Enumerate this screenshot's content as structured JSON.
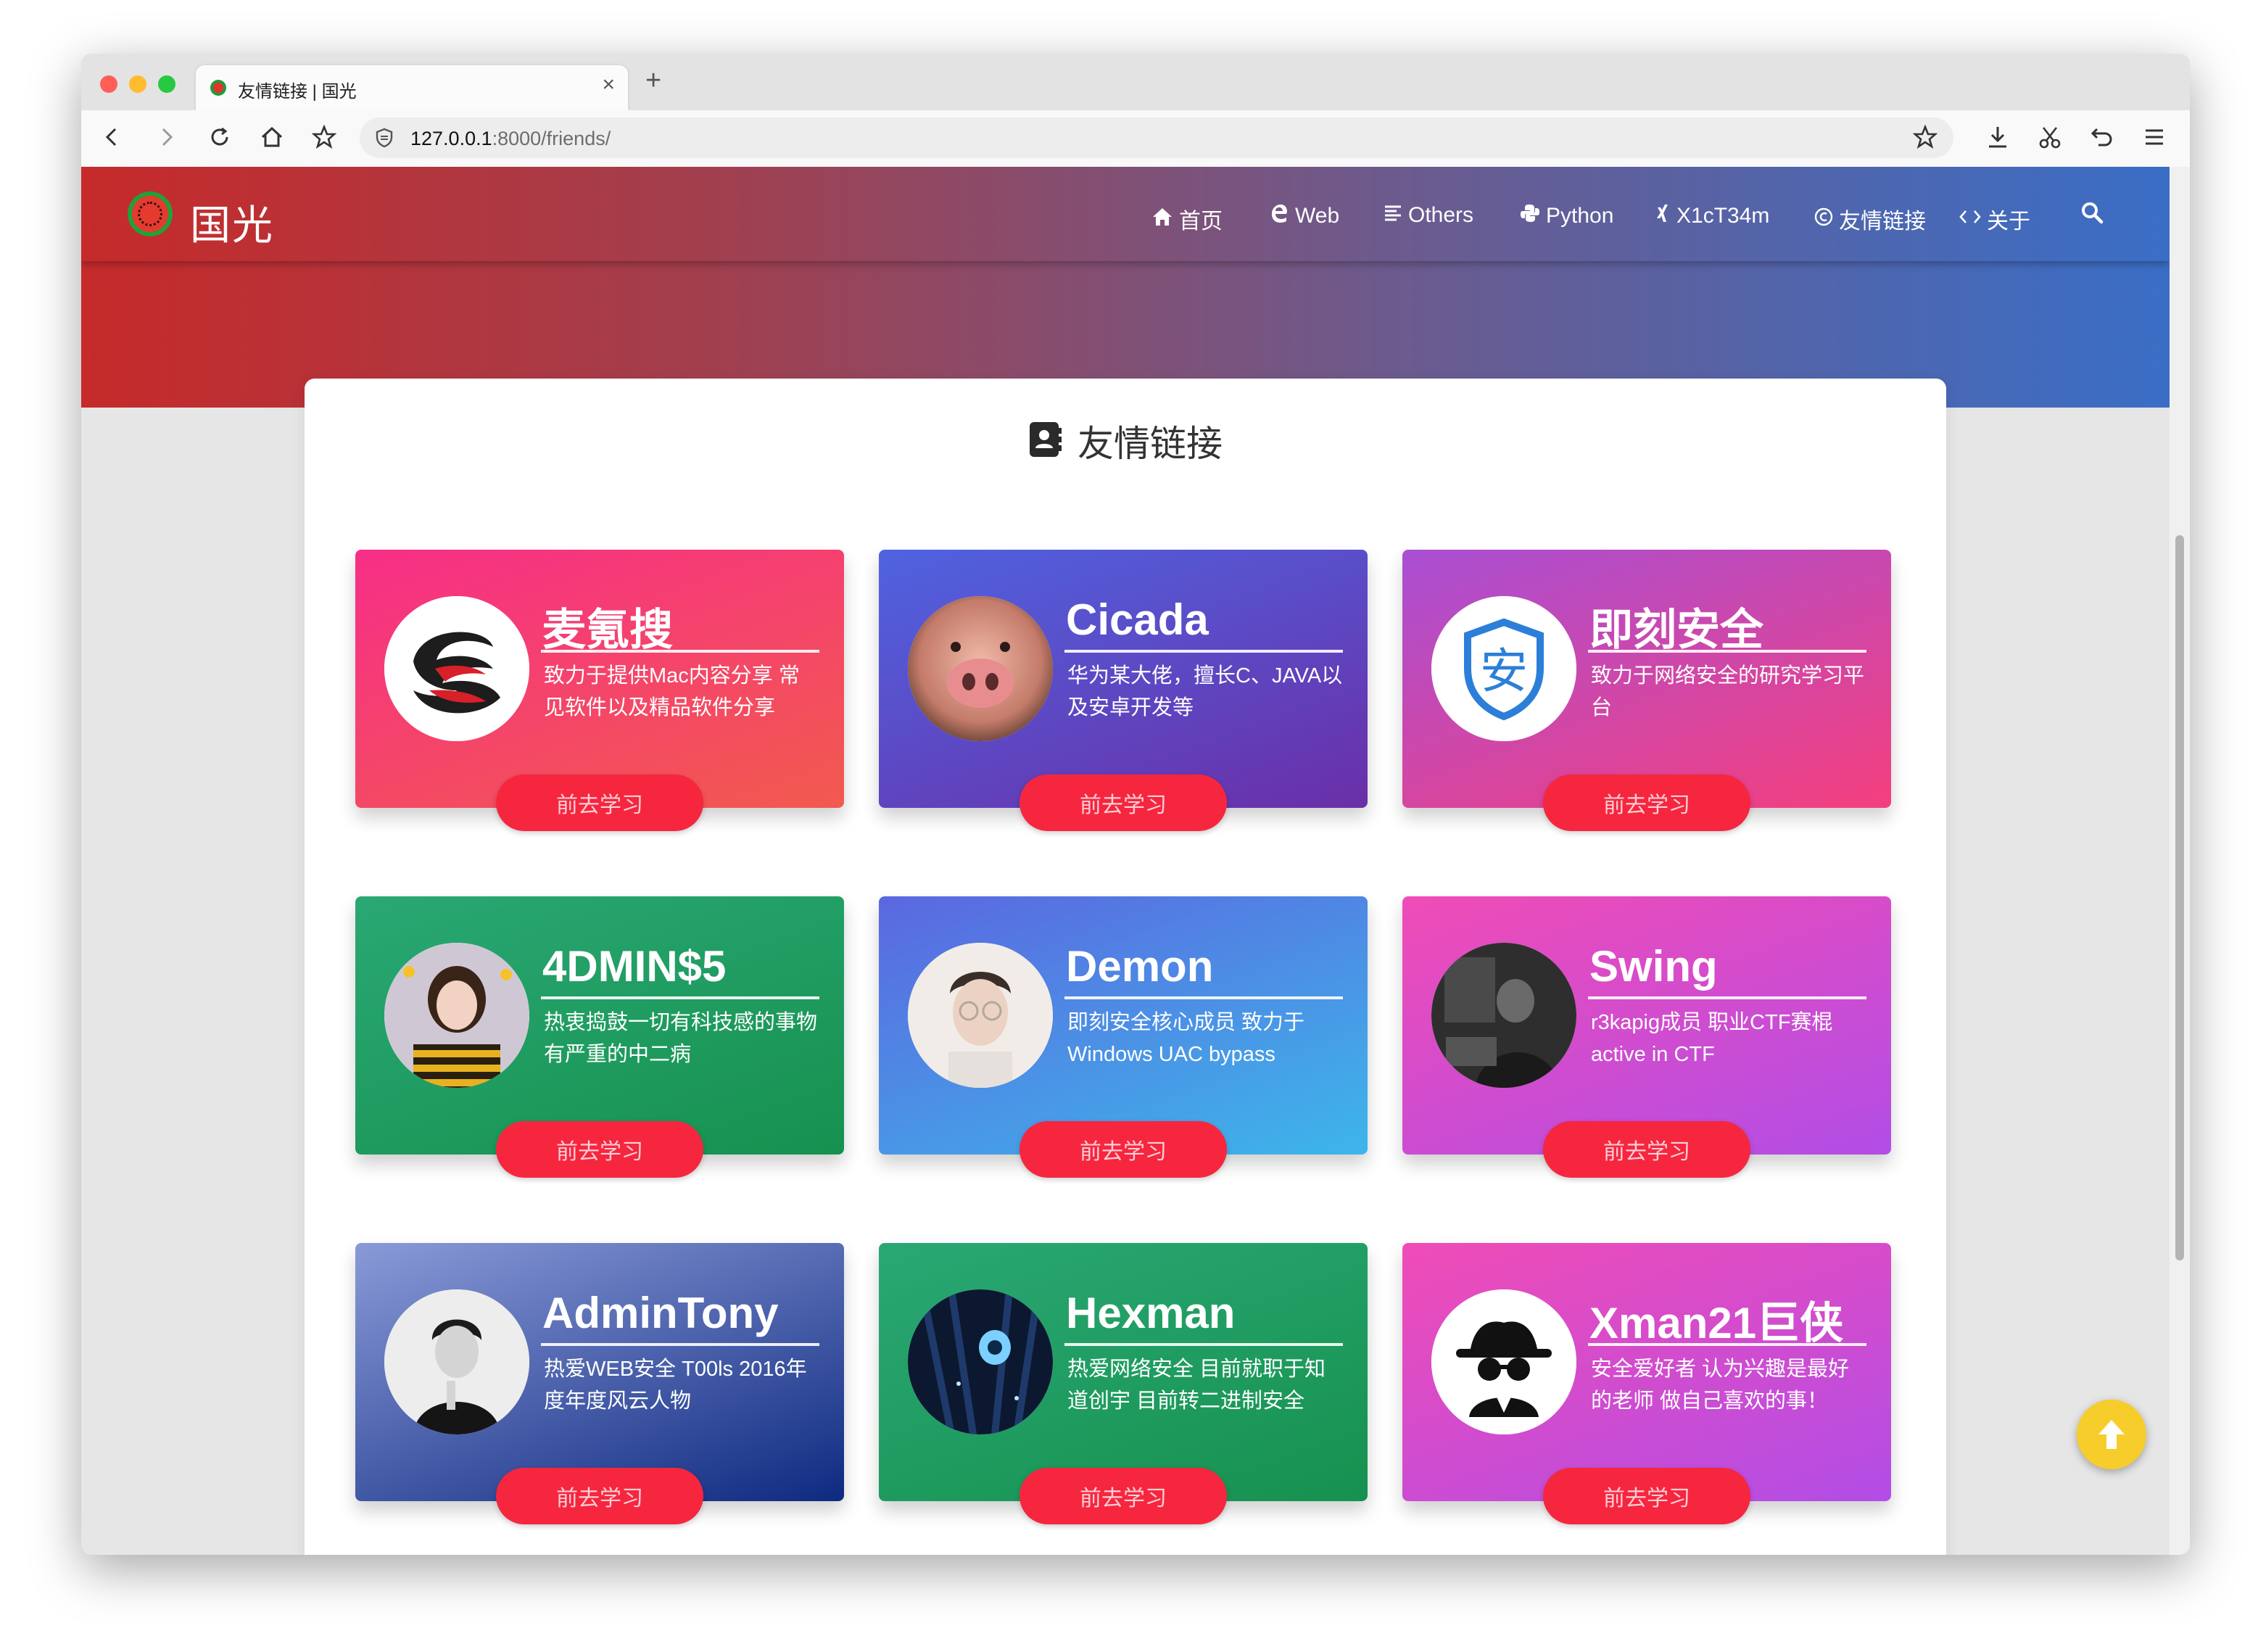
{
  "browser": {
    "tab_title": "友情链接 | 国光",
    "tab_close": "×",
    "new_tab": "+",
    "url_host": "127.0.0.1",
    "url_rest": ":8000/friends/"
  },
  "site": {
    "logo_text": "国光",
    "nav": [
      {
        "label": "首页",
        "icon": "home-icon"
      },
      {
        "label": "Web",
        "icon": "edge-icon"
      },
      {
        "label": "Others",
        "icon": "list-icon"
      },
      {
        "label": "Python",
        "icon": "python-icon"
      },
      {
        "label": "X1cT34m",
        "icon": "xing-icon"
      },
      {
        "label": "友情链接",
        "icon": "copyright-icon"
      },
      {
        "label": "关于",
        "icon": "code-icon"
      }
    ]
  },
  "page": {
    "title": "友情链接",
    "button_label": "前去学习"
  },
  "friends": [
    {
      "name": "麦氪搜",
      "desc": "致力于提供Mac内容分享 常见软件以及精品软件分享",
      "gradient": [
        "#f72e87",
        "#f25a4e"
      ],
      "avatar": "dragon-logo"
    },
    {
      "name": "Cicada",
      "desc": "华为某大佬，擅长C、JAVA以及安卓开发等",
      "gradient": [
        "#4f63e0",
        "#6a2fa8"
      ],
      "avatar": "pig-photo"
    },
    {
      "name": "即刻安全",
      "desc": "致力于网络安全的研究学习平台",
      "gradient": [
        "#a94fd3",
        "#f43f7e"
      ],
      "avatar": "shield-logo"
    },
    {
      "name": "4DMIN$5",
      "desc": "热衷捣鼓一切有科技感的事物 有严重的中二病",
      "gradient": [
        "#2aa874",
        "#16914f"
      ],
      "avatar": "girl-photo"
    },
    {
      "name": "Demon",
      "desc": "即刻安全核心成员 致力于Windows UAC bypass",
      "gradient": [
        "#5b67e0",
        "#3db6ea"
      ],
      "avatar": "man-photo"
    },
    {
      "name": "Swing",
      "desc": "r3kapig成员 职业CTF赛棍active in CTF",
      "gradient": [
        "#f04cb6",
        "#b24de6"
      ],
      "avatar": "dark-photo"
    },
    {
      "name": "AdminTony",
      "desc": "热爱WEB安全 T00ls 2016年度年度风云人物",
      "gradient": [
        "#8a9ad8",
        "#0e2a80"
      ],
      "avatar": "bw-photo"
    },
    {
      "name": "Hexman",
      "desc": "热爱网络安全 目前就职于知道创宇 目前转二进制安全",
      "gradient": [
        "#2aa874",
        "#16914f"
      ],
      "avatar": "anime-photo"
    },
    {
      "name": "Xman21巨侠",
      "desc": "安全爱好者 认为兴趣是最好的老师 做自己喜欢的事！",
      "gradient": [
        "#f04cb6",
        "#b24de6"
      ],
      "avatar": "spy-logo"
    }
  ]
}
